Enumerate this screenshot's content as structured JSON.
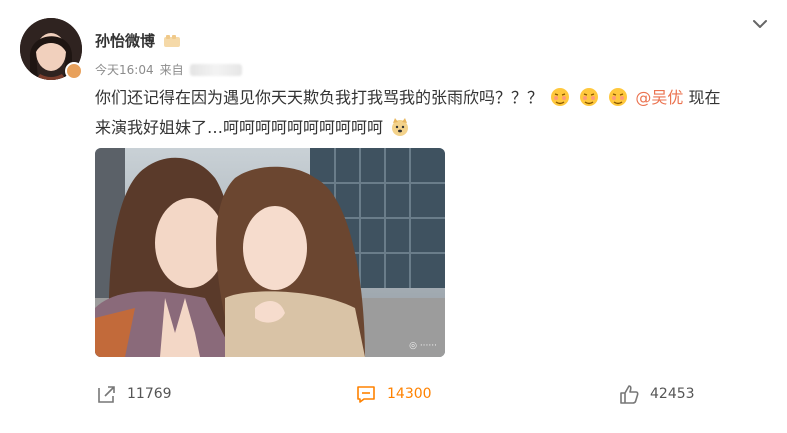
{
  "post": {
    "author": "孙怡微博",
    "time": "今天16:04",
    "source_prefix": "来自",
    "text_segments": {
      "line1": "你们还记得在因为遇见你天天欺负我打我骂我的张雨欣吗？？？",
      "mention": "@吴优",
      "after_mention": " 现在",
      "line2": "来演我好姐妹了…呵呵呵呵呵呵呵呵呵呵"
    },
    "emoji_names": [
      "shy-emoji",
      "shy-emoji",
      "shy-emoji",
      "doge-emoji"
    ]
  },
  "actions": {
    "share_count": "11769",
    "comment_count": "14300",
    "like_count": "42453"
  },
  "colors": {
    "mention": "#eb7350",
    "comment_active": "#ff8200",
    "muted_text": "#8c8c8c"
  }
}
